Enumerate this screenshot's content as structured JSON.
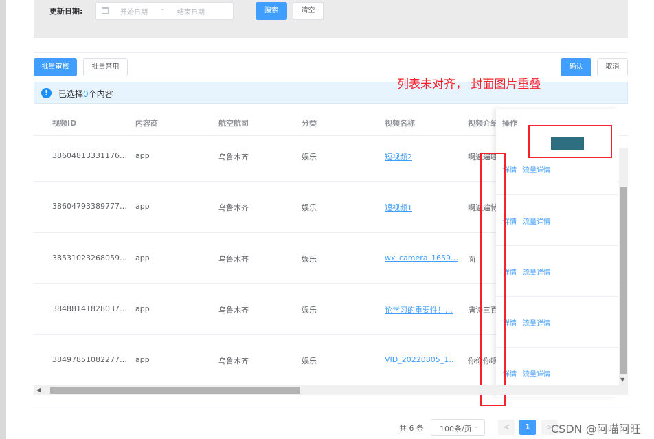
{
  "filter": {
    "label": "更新日期:",
    "start_placeholder": "开始日期",
    "separator": "-",
    "end_placeholder": "结束日期",
    "search_label": "搜索",
    "clear_label": "清空"
  },
  "toolbar": {
    "batch_review_label": "批量审核",
    "batch_disable_label": "批量禁用",
    "confirm_label": "确认",
    "cancel_label": "取消"
  },
  "alert": {
    "prefix": "已选择",
    "count": "0",
    "suffix": "个内容"
  },
  "annotation": "列表未对齐， 封面图片重叠",
  "table": {
    "columns": [
      "视频ID",
      "内容商",
      "航空航司",
      "分类",
      "视频名称",
      "视频介绍"
    ],
    "operation_header": "操作",
    "rows": [
      {
        "id": "38604813331176…",
        "provider": "app",
        "airline": "乌鲁木齐",
        "category": "娱乐",
        "name": "短视频2",
        "intro": "啊遍遍哇"
      },
      {
        "id": "38604793389777…",
        "provider": "app",
        "airline": "乌鲁木齐",
        "category": "娱乐",
        "name": "短视频1",
        "intro": "啊遍遍恃"
      },
      {
        "id": "38531023268059…",
        "provider": "app",
        "airline": "乌鲁木齐",
        "category": "娱乐",
        "name": "wx_camera_1659…",
        "intro": "面"
      },
      {
        "id": "38488141828037…",
        "provider": "app",
        "airline": "乌鲁木齐",
        "category": "娱乐",
        "name": "论学习的重要性！…",
        "intro": "唐诗三百"
      },
      {
        "id": "38497851082277…",
        "provider": "app",
        "airline": "乌鲁木齐",
        "category": "娱乐",
        "name": "VID_20220805_1…",
        "intro": "你你你呗"
      }
    ],
    "op_detail": "详情",
    "op_flow": "流量详情"
  },
  "pagination": {
    "total": "共 6 条",
    "page_size": "100条/页",
    "prev": "<",
    "current": "1",
    "next": ">"
  },
  "watermark": "CSDN @阿喵阿旺",
  "colors": {
    "primary": "#409eff",
    "annotation_red": "#f5222d"
  }
}
